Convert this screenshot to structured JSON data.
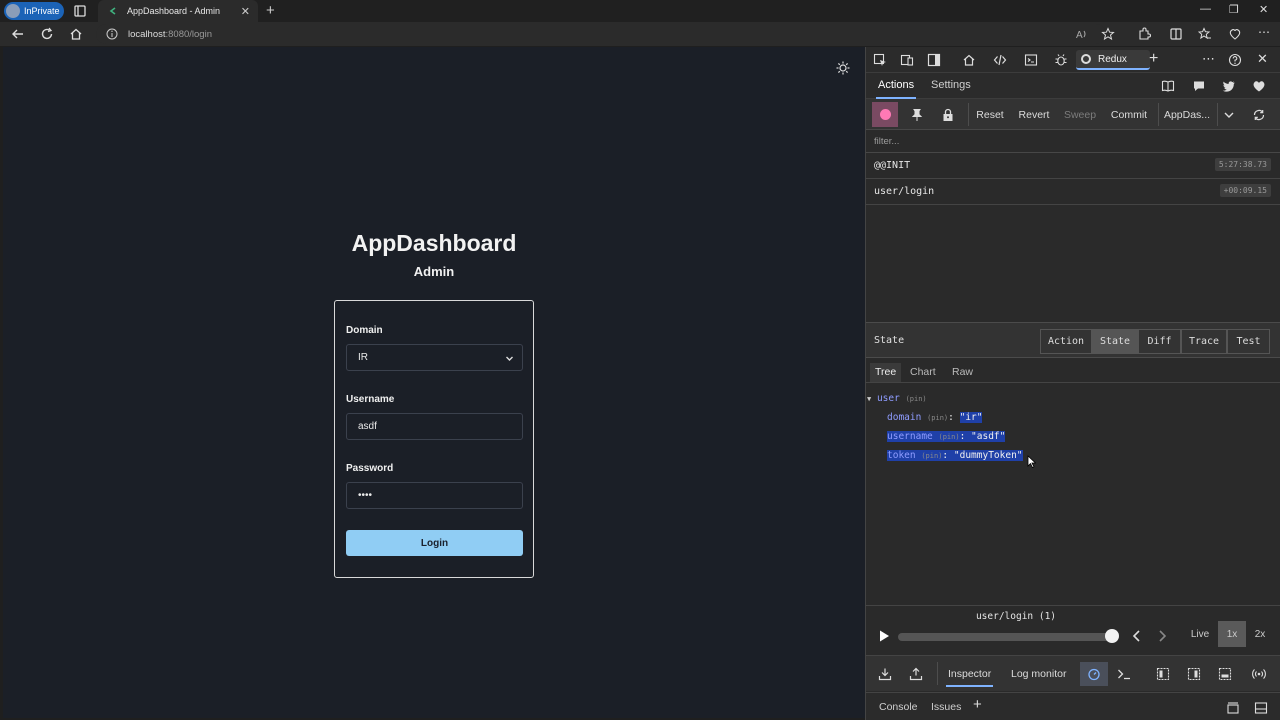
{
  "browser": {
    "profile_label": "InPrivate",
    "tab_title": "AppDashboard - Admin",
    "url_host": "localhost",
    "url_rest": ":8080/login"
  },
  "app": {
    "brand": "AppDashboard",
    "subtitle": "Admin",
    "form": {
      "domain_label": "Domain",
      "domain_value": "IR",
      "username_label": "Username",
      "username_value": "asdf",
      "password_label": "Password",
      "password_value": "••••",
      "login_button": "Login"
    }
  },
  "devtools": {
    "redux_tab": "Redux",
    "subtabs": [
      "Actions",
      "Settings"
    ],
    "controls": {
      "reset": "Reset",
      "revert": "Revert",
      "sweep": "Sweep",
      "commit": "Commit",
      "instance": "AppDas..."
    },
    "filter_placeholder": "filter...",
    "actions": [
      {
        "name": "@@INIT",
        "time": "5:27:38.73"
      },
      {
        "name": "user/login",
        "time": "+00:09.15"
      }
    ],
    "state_panel": {
      "title": "State",
      "modes": [
        "Action",
        "State",
        "Diff",
        "Trace",
        "Test"
      ],
      "views": [
        "Tree",
        "Chart",
        "Raw"
      ],
      "tree": {
        "root_key": "user",
        "pin": "(pin)",
        "entries": [
          {
            "key": "domain",
            "value": "\"ir\""
          },
          {
            "key": "username",
            "value": "\"asdf\""
          },
          {
            "key": "token",
            "value": "\"dummyToken\""
          }
        ]
      }
    },
    "slider": {
      "label": "user/login (1)",
      "live": "Live",
      "speed_1x": "1x",
      "speed_2x": "2x"
    },
    "monitor_tabs": [
      "Inspector",
      "Log monitor"
    ],
    "drawer_tabs": [
      "Console",
      "Issues"
    ]
  },
  "colors": {
    "page_bg": "#1b1f27",
    "login_button_bg": "#90cdf4",
    "selection": "#1f40a8",
    "record": "#ff79b5"
  }
}
